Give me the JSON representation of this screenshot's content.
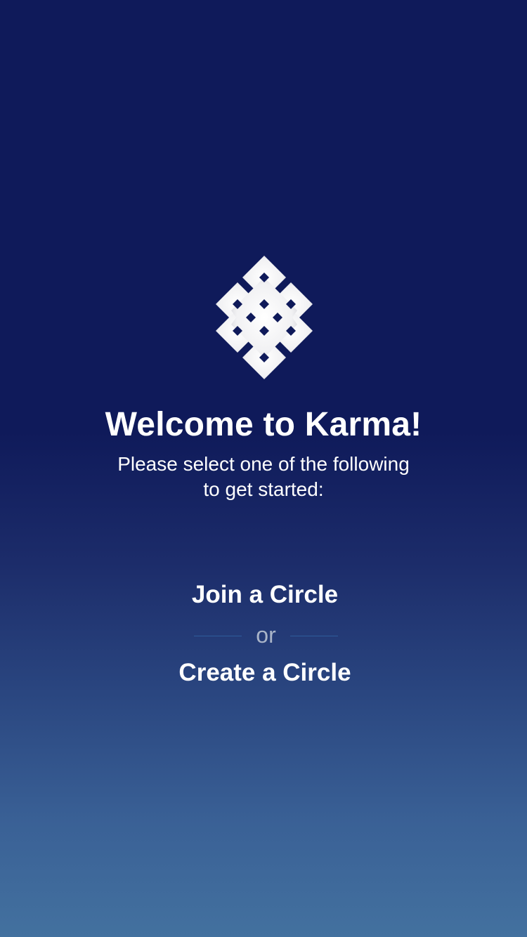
{
  "welcome": {
    "title": "Welcome to Karma!",
    "subtitle_line1": "Please select one of the following",
    "subtitle_line2": "to get started:"
  },
  "logo": {
    "icon": "endless-knot-icon"
  },
  "actions": {
    "join_label": "Join a Circle",
    "or_label": "or",
    "create_label": "Create a Circle"
  },
  "colors": {
    "background_top": "#0f1a5a",
    "background_bottom": "#43719f",
    "text": "#ffffff",
    "divider": "#2e5c9c",
    "or_text": "#a9b4c8"
  }
}
